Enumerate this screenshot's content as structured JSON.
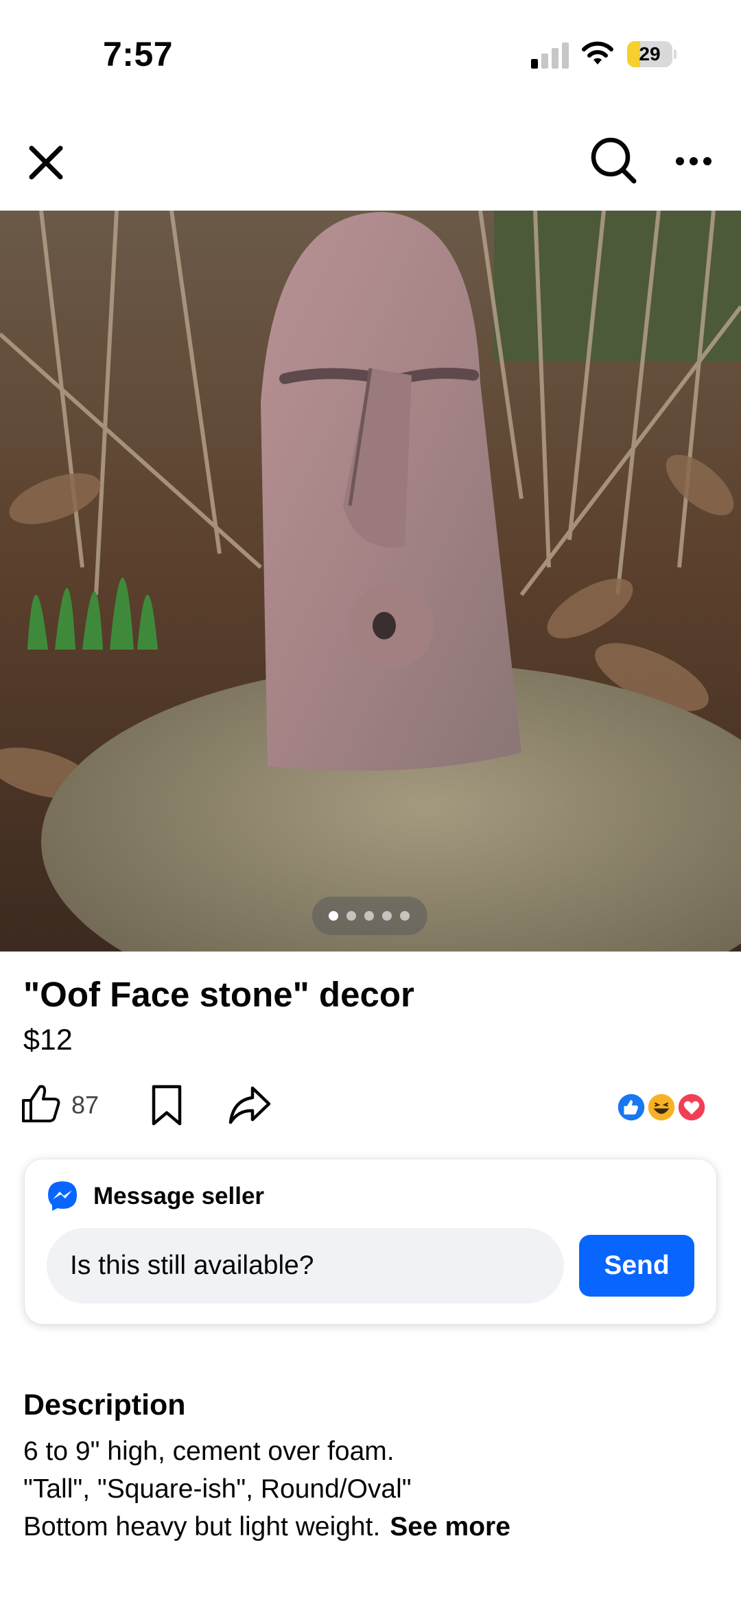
{
  "status_bar": {
    "time": "7:57",
    "battery_level": "29",
    "battery_fraction": 0.29,
    "signal_bars_active": 1,
    "signal_bars_total": 4
  },
  "nav": {
    "close_icon": "close-icon",
    "search_icon": "search-icon",
    "more_icon": "more-icon"
  },
  "carousel": {
    "image_count": 5,
    "active_index": 0
  },
  "listing": {
    "title": "\"Oof Face stone\" decor",
    "price": "$12"
  },
  "actions": {
    "like_count": "87",
    "icons": [
      "like-icon",
      "bookmark-icon",
      "share-icon"
    ],
    "reactions": [
      "like",
      "haha",
      "love"
    ]
  },
  "message": {
    "title": "Message seller",
    "input_value": "Is this still available?",
    "send_label": "Send"
  },
  "description": {
    "heading": "Description",
    "lines": [
      "6 to 9\" high, cement over foam.",
      "\"Tall\", \"Square-ish\", Round/Oval\"",
      "Bottom heavy but light weight."
    ],
    "see_more": "See more"
  },
  "colors": {
    "accent": "#0866ff",
    "text": "#050505",
    "input_bg": "#f0f2f5",
    "battery": "#f7cf2e",
    "love": "#f33e58",
    "haha": "#f7b125"
  }
}
